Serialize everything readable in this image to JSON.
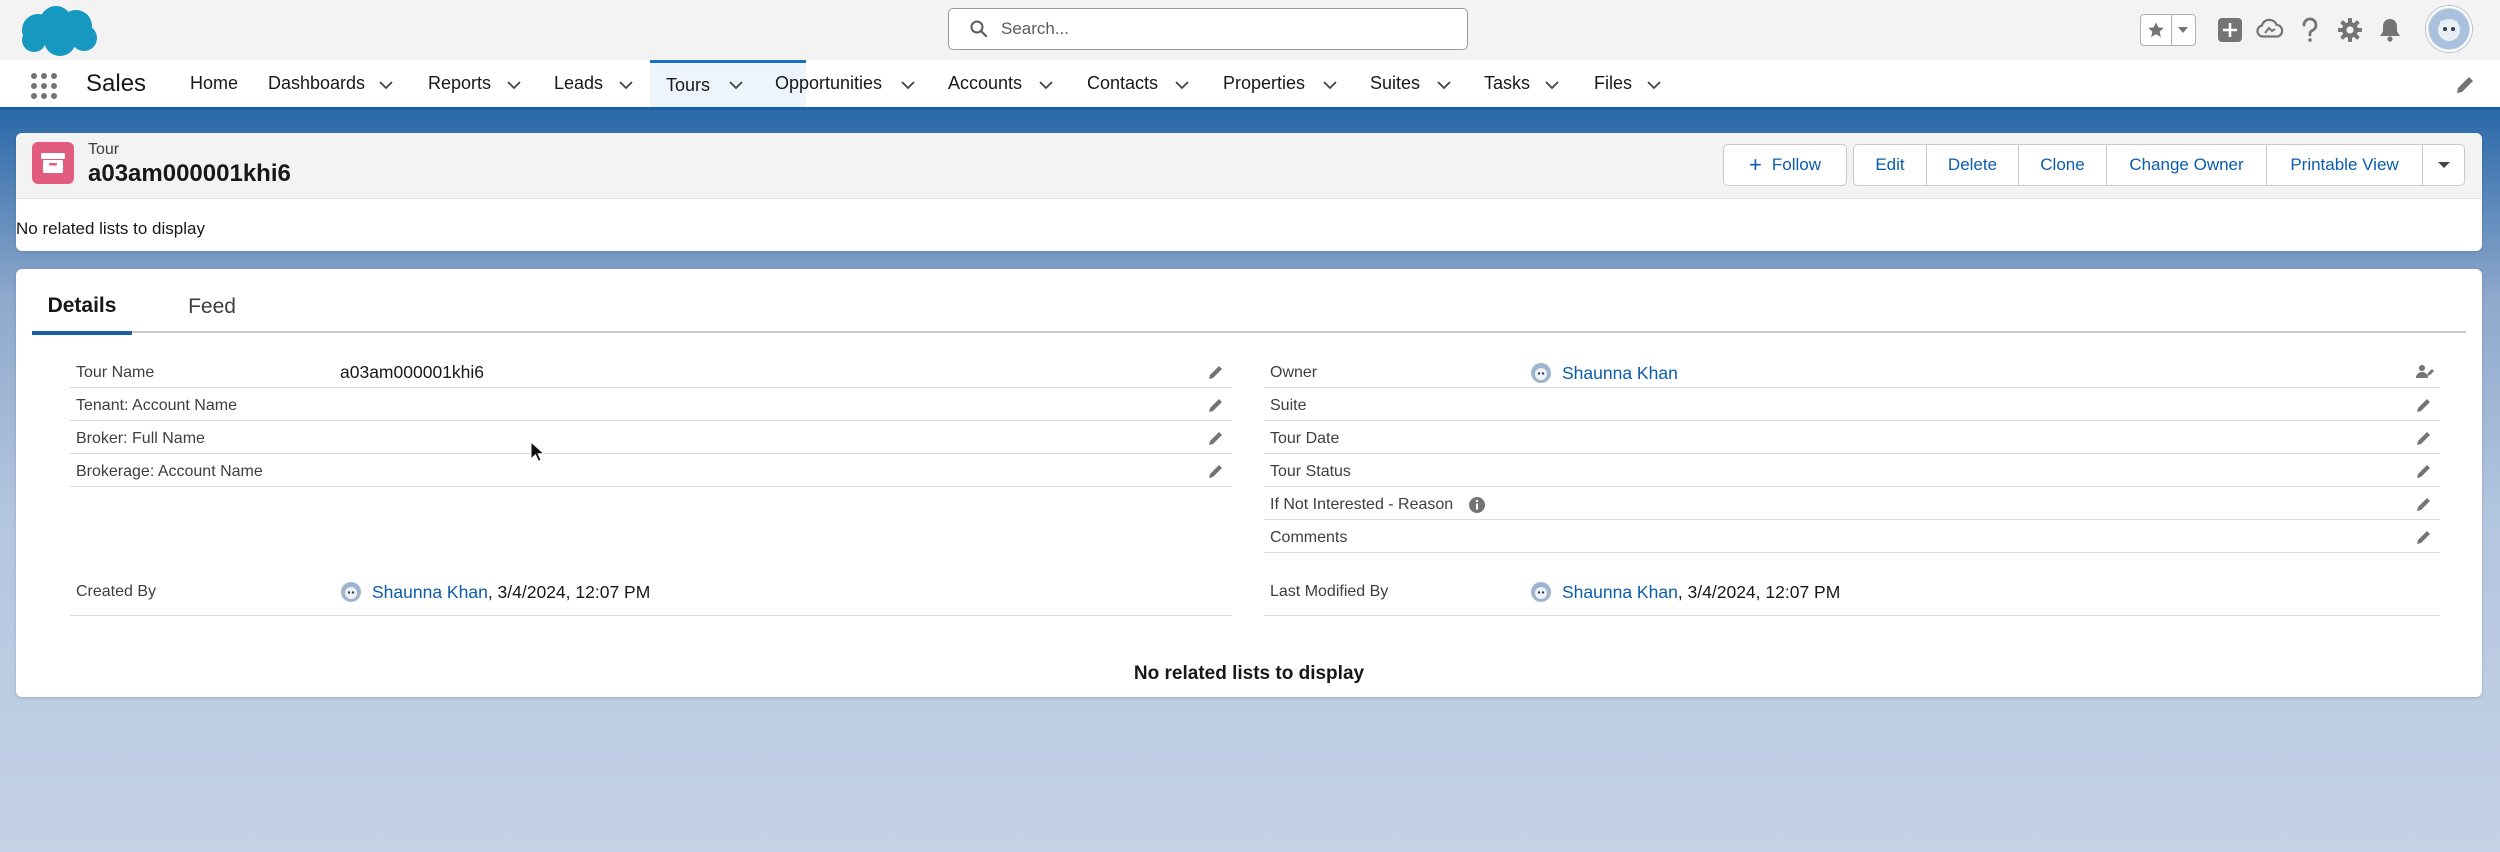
{
  "global_header": {
    "search_placeholder": "Search...",
    "icons": [
      "salesforce-logo",
      "search-icon",
      "favorites-star-icon",
      "favorites-caret-icon",
      "global-add-icon",
      "trailhead-icon",
      "help-icon",
      "setup-gear-icon",
      "notifications-bell-icon",
      "user-avatar"
    ]
  },
  "app_nav": {
    "app_name": "Sales",
    "items": [
      {
        "label": "Home",
        "has_menu": false
      },
      {
        "label": "Dashboards",
        "has_menu": true
      },
      {
        "label": "Reports",
        "has_menu": true
      },
      {
        "label": "Leads",
        "has_menu": true
      },
      {
        "label": "Tours",
        "has_menu": true,
        "active": true
      },
      {
        "label": "Opportunities",
        "has_menu": true
      },
      {
        "label": "Accounts",
        "has_menu": true
      },
      {
        "label": "Contacts",
        "has_menu": true
      },
      {
        "label": "Properties",
        "has_menu": true
      },
      {
        "label": "Suites",
        "has_menu": true
      },
      {
        "label": "Tasks",
        "has_menu": true
      },
      {
        "label": "Files",
        "has_menu": true
      }
    ]
  },
  "record_header": {
    "entity_label": "Tour",
    "title": "a03am000001khi6",
    "actions": {
      "follow": "Follow",
      "edit": "Edit",
      "delete": "Delete",
      "clone": "Clone",
      "change_owner": "Change Owner",
      "printable_view": "Printable View"
    },
    "related_note": "No related lists to display"
  },
  "details": {
    "tabs": [
      {
        "label": "Details",
        "active": true
      },
      {
        "label": "Feed",
        "active": false
      }
    ],
    "left_fields": [
      {
        "label": "Tour Name",
        "value": "a03am000001khi6"
      },
      {
        "label": "Tenant: Account Name",
        "value": ""
      },
      {
        "label": "Broker: Full Name",
        "value": ""
      },
      {
        "label": "Brokerage: Account Name",
        "value": ""
      }
    ],
    "right_fields": [
      {
        "label": "Owner",
        "value": "Shaunna Khan"
      },
      {
        "label": "Suite",
        "value": ""
      },
      {
        "label": "Tour Date",
        "value": ""
      },
      {
        "label": "Tour Status",
        "value": ""
      },
      {
        "label": "If Not Interested - Reason",
        "value": ""
      },
      {
        "label": "Comments",
        "value": ""
      }
    ],
    "created_by": {
      "label": "Created By",
      "user": "Shaunna Khan",
      "date": ", 3/4/2024, 12:07 PM"
    },
    "last_modified_by": {
      "label": "Last Modified By",
      "user": "Shaunna Khan",
      "date": ", 3/4/2024, 12:07 PM"
    },
    "related_note": "No related lists to display"
  },
  "colors": {
    "brand_blue": "#0b5cab",
    "nav_accent": "#1b5fa5",
    "entity_icon": "#e25c80",
    "logo_blue": "#1798c1"
  }
}
